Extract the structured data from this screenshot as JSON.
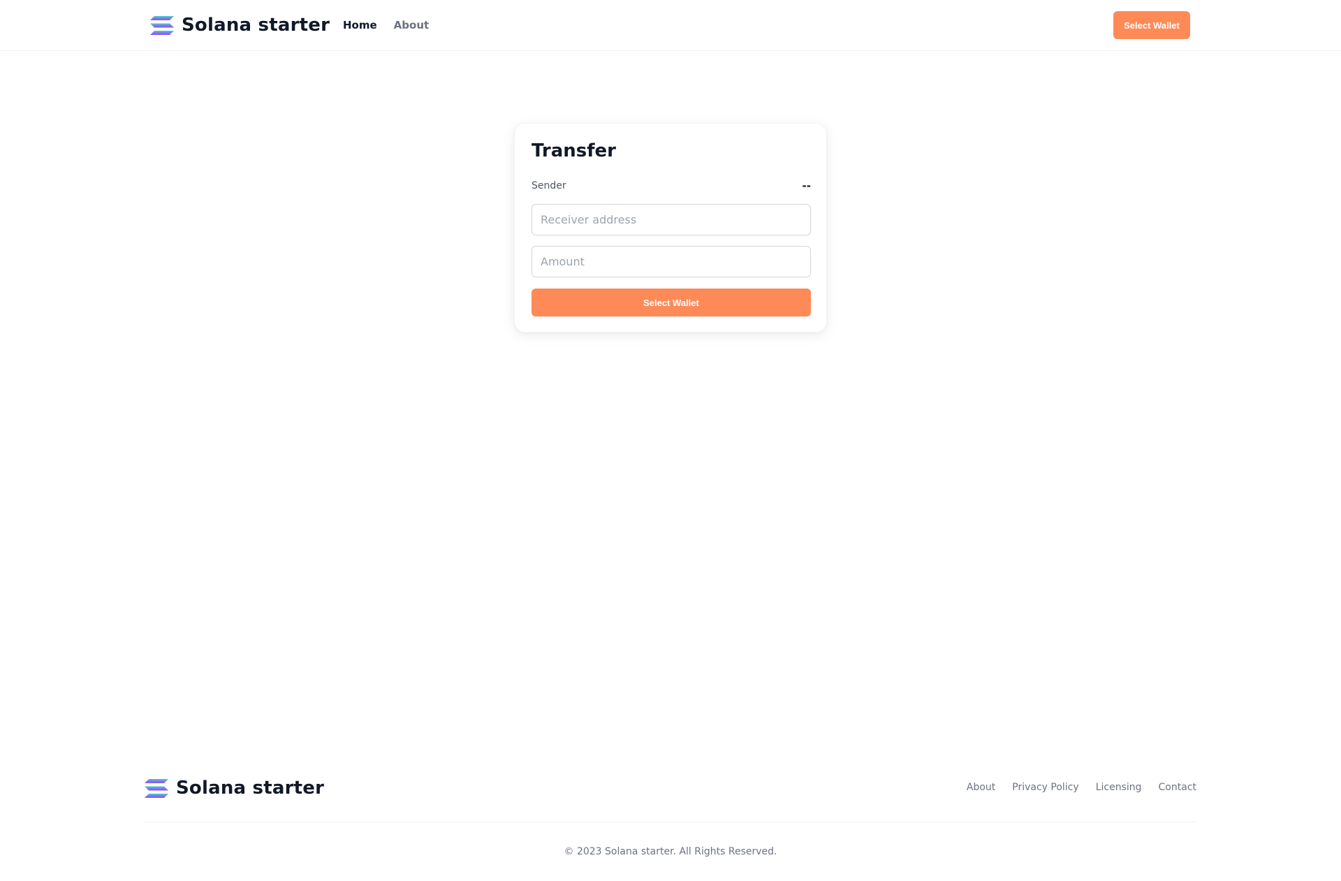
{
  "header": {
    "brand_name": "Solana starter",
    "logo_icon": "solana-logo-icon",
    "nav": [
      {
        "label": "Home",
        "active": true
      },
      {
        "label": "About",
        "active": false
      }
    ],
    "wallet_button_label": "Select Wallet"
  },
  "transfer": {
    "title": "Transfer",
    "sender_label": "Sender",
    "sender_value": "--",
    "receiver_placeholder": "Receiver address",
    "receiver_value": "",
    "amount_placeholder": "Amount",
    "amount_value": "",
    "wallet_button_label": "Select Wallet"
  },
  "footer": {
    "brand_name": "Solana starter",
    "links": [
      "About",
      "Privacy Policy",
      "Licensing",
      "Contact"
    ],
    "copyright": "© 2023 Solana starter. All Rights Reserved."
  },
  "colors": {
    "accent": "#fe8a58",
    "text_primary": "#111827",
    "text_muted": "#6b7280",
    "logo_gradient_start": "#3dd6c2",
    "logo_gradient_end": "#9945ff"
  }
}
